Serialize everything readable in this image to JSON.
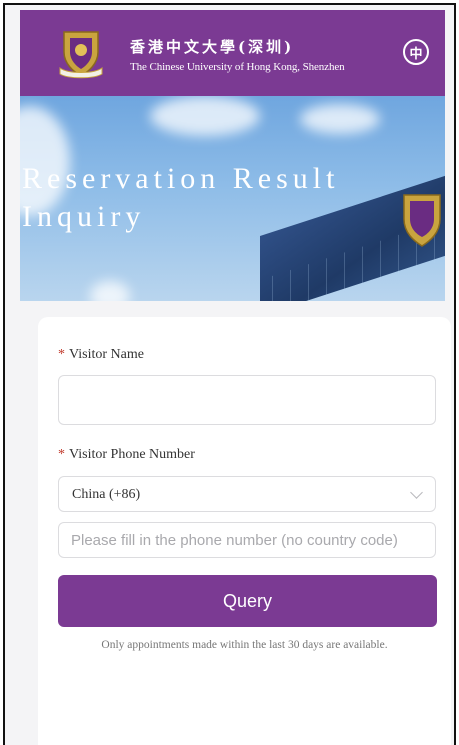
{
  "header": {
    "title_cn": "香港中文大學(深圳)",
    "title_en": "The Chinese University of Hong Kong, Shenzhen",
    "lang_toggle": "中",
    "logo_icon": "cuhk-crest-logo",
    "color": "#7b3a93"
  },
  "banner": {
    "title": "Reservation Result Inquiry"
  },
  "form": {
    "visitor_name": {
      "required_mark": "*",
      "label": "Visitor Name",
      "value": "",
      "placeholder": ""
    },
    "visitor_phone": {
      "required_mark": "*",
      "label": "Visitor Phone Number",
      "country_code": "China (+86)",
      "value": "",
      "placeholder": "Please fill in the phone number (no country code)"
    },
    "query_label": "Query",
    "note": "Only appointments made within the last 30 days are available."
  }
}
